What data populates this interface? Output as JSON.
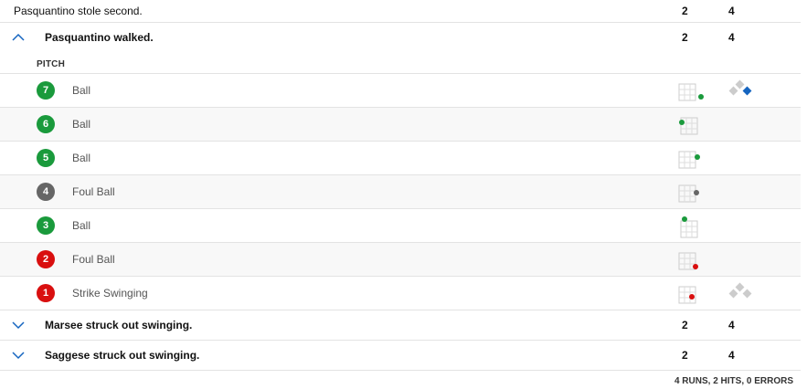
{
  "plays": [
    {
      "text": "Pasquantino stole second.",
      "away": "2",
      "home": "4"
    },
    {
      "text": "Pasquantino walked.",
      "away": "2",
      "home": "4"
    },
    {
      "text": "Marsee struck out swinging.",
      "away": "2",
      "home": "4"
    },
    {
      "text": "Saggese struck out swinging.",
      "away": "2",
      "home": "4"
    }
  ],
  "pitch_header": "PITCH",
  "pitches": [
    {
      "num": "7",
      "label": "Ball",
      "color": "#1a9a3c"
    },
    {
      "num": "6",
      "label": "Ball",
      "color": "#1a9a3c"
    },
    {
      "num": "5",
      "label": "Ball",
      "color": "#1a9a3c"
    },
    {
      "num": "4",
      "label": "Foul Ball",
      "color": "#666666"
    },
    {
      "num": "3",
      "label": "Ball",
      "color": "#1a9a3c"
    },
    {
      "num": "2",
      "label": "Foul Ball",
      "color": "#d90f0f"
    },
    {
      "num": "1",
      "label": "Strike Swinging",
      "color": "#d90f0f"
    }
  ],
  "summary": "4 RUNS, 2 HITS, 0 ERRORS",
  "colors": {
    "ball": "#1a9a3c",
    "foul": "#666666",
    "strike": "#d90f0f",
    "runner": "#1565c0",
    "base_empty": "#cccccc"
  },
  "icons": {
    "expand": "chevron-down-icon",
    "collapse": "chevron-up-icon",
    "zone": "strike-zone-icon",
    "bases": "bases-diamond-icon"
  }
}
